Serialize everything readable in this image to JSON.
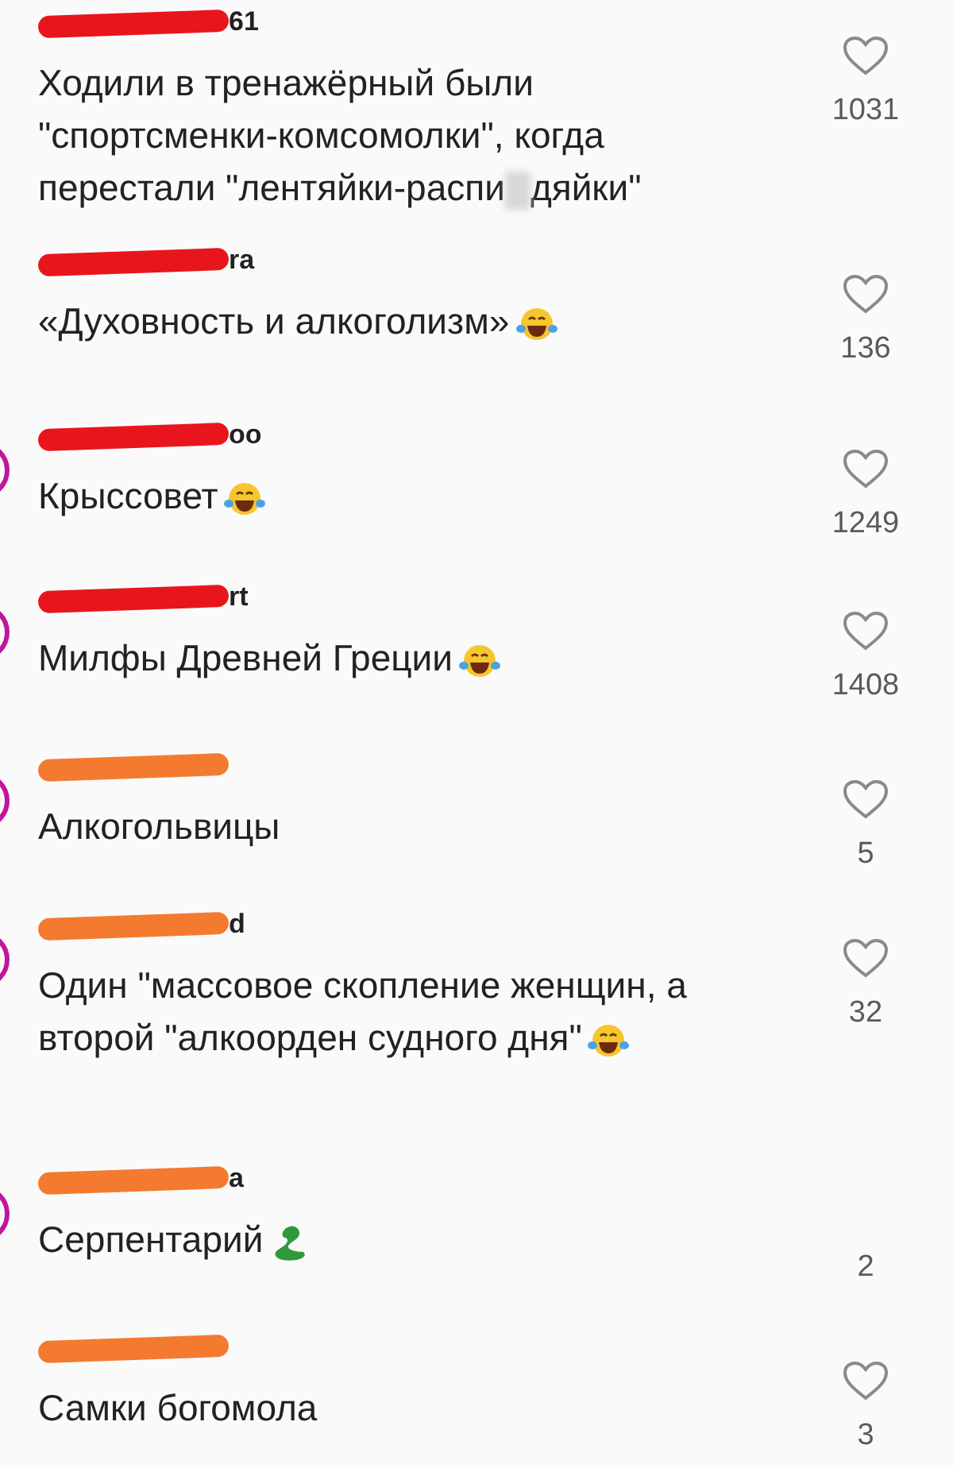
{
  "comments": [
    {
      "username_visible": "61",
      "color": "#e8161c",
      "avatar_visible": false,
      "segments": [
        {
          "kind": "text",
          "text": "Ходили в тренажёрный были \"спортсменки-комсомолки\", когда перестали \"лентяйки-распи"
        },
        {
          "kind": "blur"
        },
        {
          "kind": "text",
          "text": "дяйки\""
        }
      ],
      "heart_visible": true,
      "likes": "1031"
    },
    {
      "username_visible": "ra",
      "color": "#e8161c",
      "avatar_visible": false,
      "segments": [
        {
          "kind": "text",
          "text": "«Духовность и алкоголизм»"
        },
        {
          "kind": "laugh"
        }
      ],
      "heart_visible": true,
      "likes": "136"
    },
    {
      "username_visible": "oo",
      "color": "#e8161c",
      "avatar_visible": true,
      "segments": [
        {
          "kind": "text",
          "text": "Крыссовет"
        },
        {
          "kind": "laugh"
        }
      ],
      "heart_visible": true,
      "likes": "1249"
    },
    {
      "username_visible": "rt",
      "color": "#e8161c",
      "avatar_visible": true,
      "segments": [
        {
          "kind": "text",
          "text": "Милфы Древней Греции"
        },
        {
          "kind": "laugh"
        }
      ],
      "heart_visible": true,
      "likes": "1408"
    },
    {
      "color": "#f47a30",
      "avatar_visible": true,
      "segments": [
        {
          "kind": "text",
          "text": "Алкогольвицы"
        }
      ],
      "heart_visible": true,
      "likes": "5"
    },
    {
      "username_visible": "d",
      "color": "#f47a30",
      "avatar_visible": true,
      "segments": [
        {
          "kind": "text",
          "text": "Один \"массовое скопление женщин, а второй \"алкоорден судного дня\""
        },
        {
          "kind": "laugh"
        }
      ],
      "heart_visible": true,
      "likes": "32"
    },
    {
      "username_visible": "a",
      "color": "#f47a30",
      "avatar_visible": true,
      "segments": [
        {
          "kind": "text",
          "text": "Серпентарий"
        },
        {
          "kind": "snake"
        }
      ],
      "heart_visible": false,
      "likes": "2"
    },
    {
      "color": "#f47a30",
      "avatar_visible": false,
      "segments": [
        {
          "kind": "text",
          "text": "Самки богомола"
        }
      ],
      "heart_visible": true,
      "likes": "3"
    }
  ]
}
